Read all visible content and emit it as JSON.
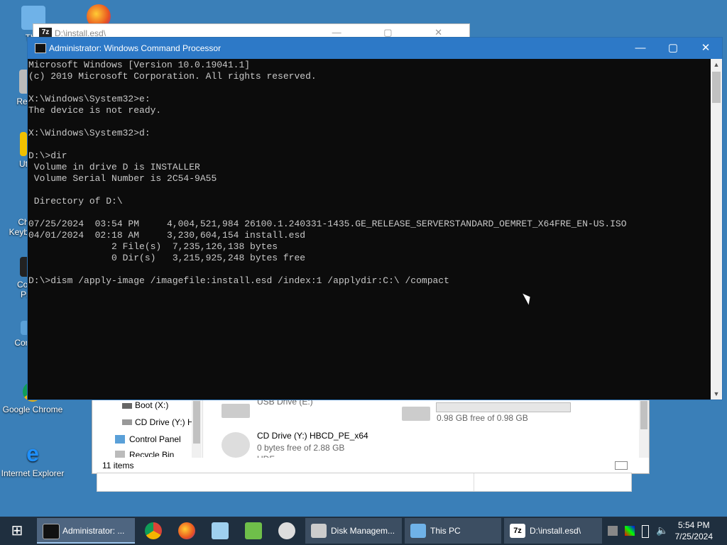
{
  "desktop": {
    "icons": [
      {
        "label": "This",
        "name": "this-pc-icon"
      },
      {
        "label": "Recy",
        "name": "recycle-bin-icon"
      },
      {
        "label": "Ut",
        "name": "utilities-icon"
      },
      {
        "label": "Ch",
        "name": "keyboard-icon"
      },
      {
        "label": "Keyboa",
        "name": "keyboard-label"
      },
      {
        "label": "Con",
        "name": "command-prompt-icon"
      },
      {
        "label": "Pr",
        "name": "command-prompt-label"
      },
      {
        "label": "Contr",
        "name": "control-panel-icon"
      },
      {
        "label": "Google Chrome",
        "name": "chrome-icon"
      },
      {
        "label": "Internet Explorer",
        "name": "internet-explorer-icon"
      }
    ]
  },
  "window_7z": {
    "title": "D:\\install.esd\\",
    "badge": "7z"
  },
  "explorer": {
    "nav": [
      {
        "label": "Boot (X:)"
      },
      {
        "label": "CD Drive (Y:) H"
      },
      {
        "label": "Control Panel"
      },
      {
        "label": "Recycle Bin"
      }
    ],
    "status": "11 items",
    "drives": [
      {
        "name": "USB Drive (E:)"
      },
      {
        "name": "CD Drive (Y:) HBCD_PE_x64",
        "free": "0 bytes free of 2.88 GB",
        "fs": "UDF"
      },
      {
        "free_text": "0.98 GB free of 0.98 GB"
      }
    ]
  },
  "cmd": {
    "title": "Administrator: Windows Command Processor",
    "lines": [
      "Microsoft Windows [Version 10.0.19041.1]",
      "(c) 2019 Microsoft Corporation. All rights reserved.",
      "",
      "X:\\Windows\\System32>e:",
      "The device is not ready.",
      "",
      "X:\\Windows\\System32>d:",
      "",
      "D:\\>dir",
      " Volume in drive D is INSTALLER",
      " Volume Serial Number is 2C54-9A55",
      "",
      " Directory of D:\\",
      "",
      "07/25/2024  03:54 PM     4,004,521,984 26100.1.240331-1435.GE_RELEASE_SERVERSTANDARD_OEMRET_X64FRE_EN-US.ISO",
      "04/01/2024  02:18 AM     3,230,604,154 install.esd",
      "               2 File(s)  7,235,126,138 bytes",
      "               0 Dir(s)   3,215,925,248 bytes free",
      "",
      "D:\\>dism /apply-image /imagefile:install.esd /index:1 /applydir:C:\\ /compact"
    ]
  },
  "taskbar": {
    "apps": [
      {
        "label": "Administrator: ...",
        "name": "taskbar-cmd"
      },
      {
        "label": "Disk Managem...",
        "name": "taskbar-disk-management"
      },
      {
        "label": "This PC",
        "name": "taskbar-this-pc"
      },
      {
        "label": "D:\\install.esd\\",
        "name": "taskbar-7zip"
      }
    ],
    "time": "5:54 PM",
    "date": "7/25/2024"
  }
}
